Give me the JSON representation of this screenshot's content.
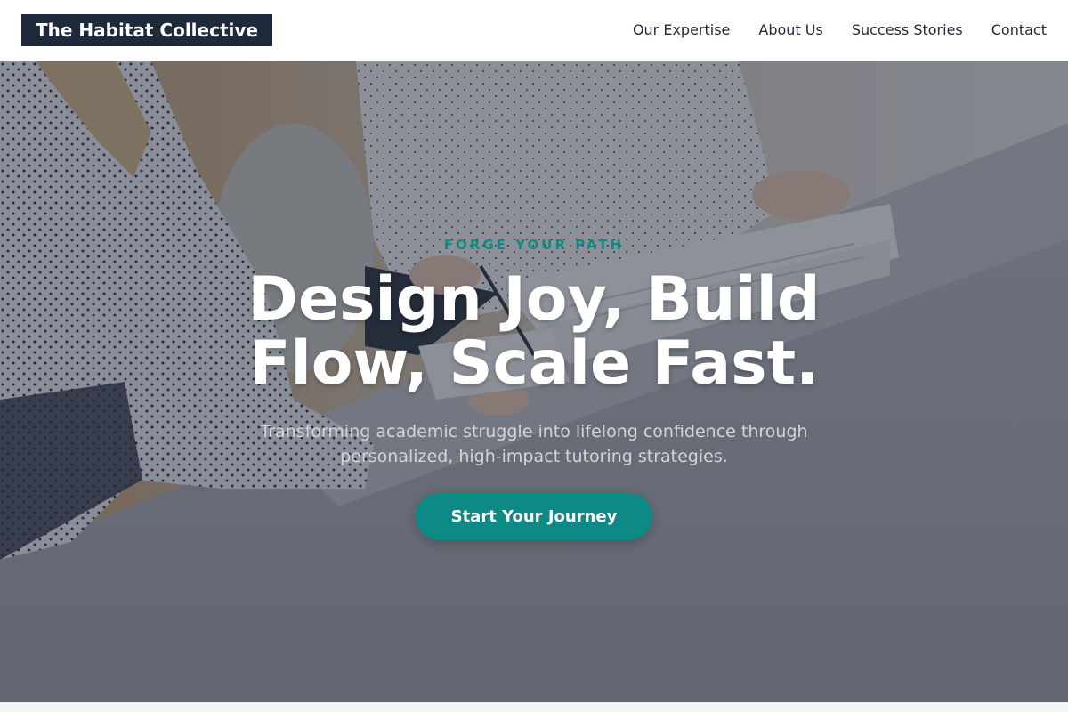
{
  "header": {
    "brand": "The Habitat Collective",
    "nav": [
      {
        "label": "Our Expertise"
      },
      {
        "label": "About Us"
      },
      {
        "label": "Success Stories"
      },
      {
        "label": "Contact"
      }
    ]
  },
  "hero": {
    "eyebrow": "FORGE YOUR PATH",
    "headline_line1": "Design Joy, Build",
    "headline_line2": "Flow, Scale Fast.",
    "subhead_line1": "Transforming academic struggle into lifelong confidence through",
    "subhead_line2": "personalized, high-impact tutoring strategies.",
    "cta_label": "Start Your Journey"
  },
  "colors": {
    "accent": "#0e8a86",
    "brand_bg": "#1e293b",
    "overlay": "#1e2434"
  }
}
